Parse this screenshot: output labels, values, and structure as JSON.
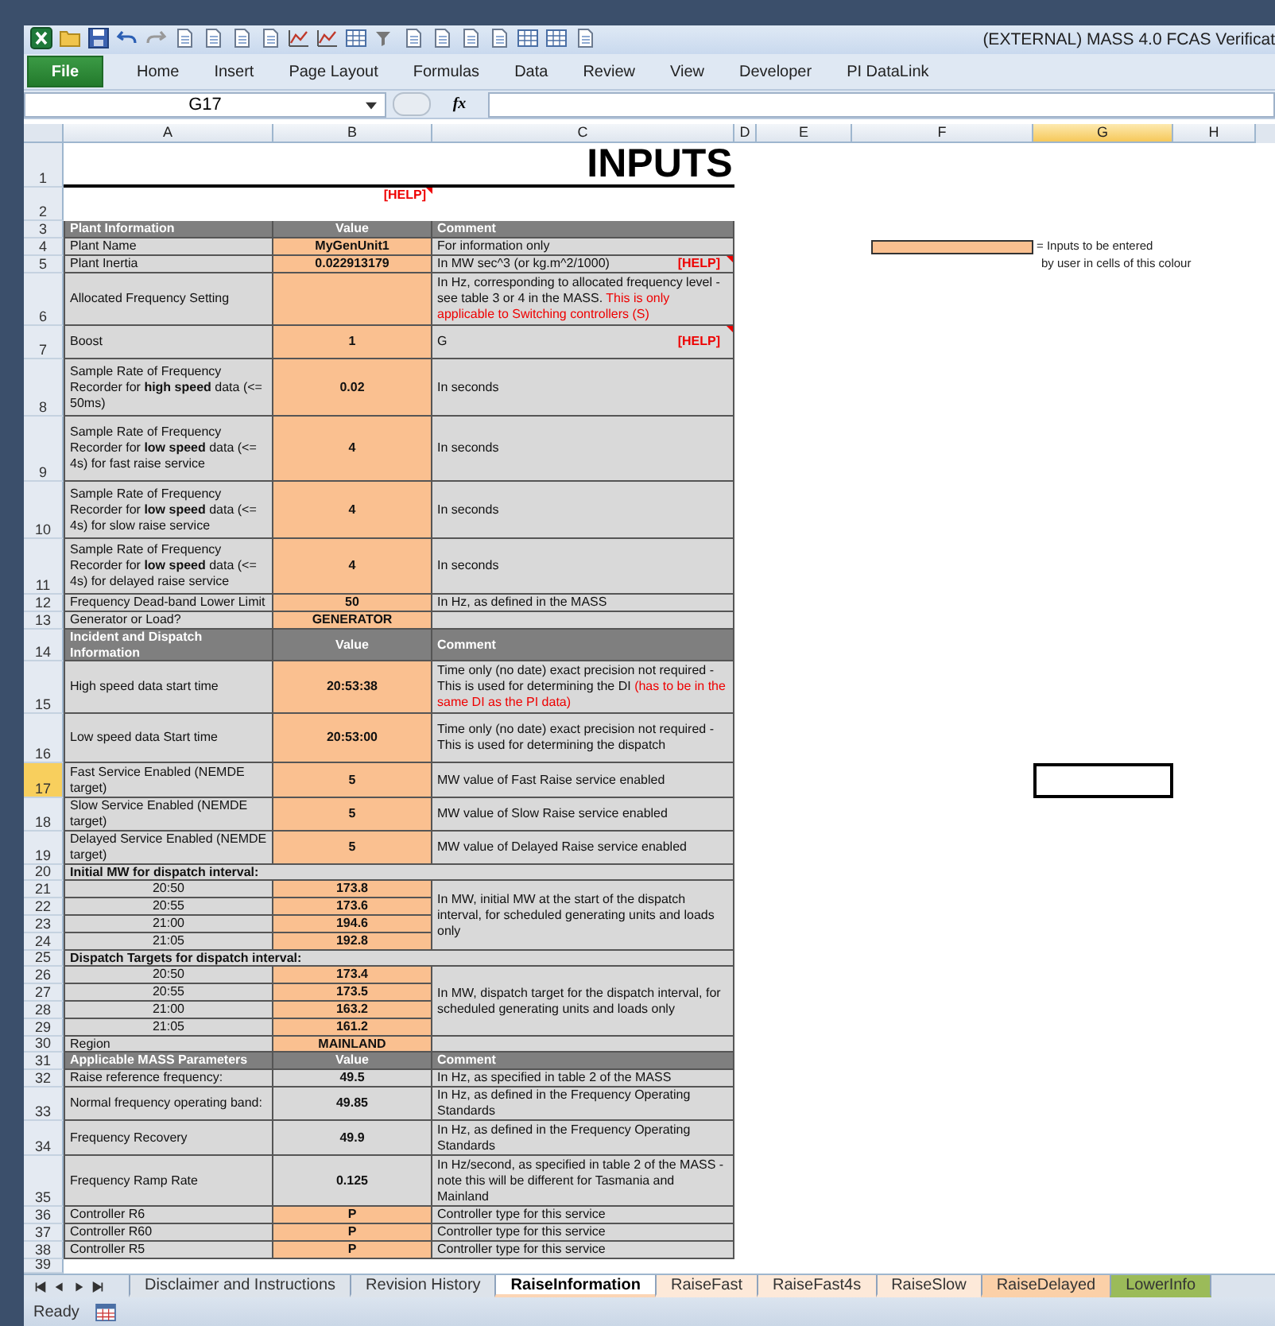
{
  "window": {
    "title": "(EXTERNAL) MASS 4.0 FCAS Verificat"
  },
  "file_button": "File",
  "ribbon_tabs": [
    "Home",
    "Insert",
    "Page Layout",
    "Formulas",
    "Data",
    "Review",
    "View",
    "Developer",
    "PI DataLink"
  ],
  "name_box": "G17",
  "formula_label": "fx",
  "columns": [
    {
      "label": "A",
      "selected": false
    },
    {
      "label": "B",
      "selected": false
    },
    {
      "label": "C",
      "selected": false
    },
    {
      "label": "D",
      "selected": false
    },
    {
      "label": "E",
      "selected": false
    },
    {
      "label": "F",
      "selected": false
    },
    {
      "label": "G",
      "selected": true
    },
    {
      "label": "H",
      "selected": false
    }
  ],
  "legend": {
    "line_1": "= Inputs to be entered",
    "line_2": "by user in cells of this colour"
  },
  "sheet": {
    "rows": [
      {
        "number": "1",
        "selected": false,
        "kind": "title",
        "text": "INPUTS"
      },
      {
        "number": "2",
        "selected": false,
        "kind": "help",
        "help": "[HELP]",
        "has_note": true
      },
      {
        "number": "3",
        "selected": false,
        "kind": "header",
        "label": "Plant Information",
        "value": "Value",
        "comment": "Comment"
      },
      {
        "number": "4",
        "selected": false,
        "kind": "field",
        "label": "Plant Name",
        "value": "MyGenUnit1",
        "input": true,
        "comment": "For information only"
      },
      {
        "number": "5",
        "selected": false,
        "kind": "field",
        "label": "Plant Inertia",
        "value": "0.022913179",
        "input": true,
        "comment": "In MW sec^3 (or kg.m^2/1000)",
        "help": "[HELP]",
        "has_note": true
      },
      {
        "number": "6",
        "selected": false,
        "kind": "field",
        "label": "Allocated Frequency Setting",
        "input": true,
        "comment": "In Hz, corresponding to allocated frequency level - see table 3 or 4 in the MASS.",
        "note": "This is only applicable to Switching controllers (S)"
      },
      {
        "number": "7",
        "selected": false,
        "kind": "field",
        "label": "Boost",
        "value": "1",
        "input": true,
        "comment": "G",
        "help": "[HELP]",
        "has_note": true
      },
      {
        "number": "8",
        "selected": false,
        "kind": "field",
        "label": "Sample Rate of Frequency Recorder for **high speed** data (<= 50ms)",
        "value": "0.02",
        "input": true,
        "comment": "In seconds"
      },
      {
        "number": "9",
        "selected": false,
        "kind": "field",
        "label": "Sample Rate of Frequency Recorder for **low speed** data (<= 4s) for fast raise service",
        "value": "4",
        "input": true,
        "comment": "In seconds"
      },
      {
        "number": "10",
        "selected": false,
        "kind": "field",
        "label": "Sample Rate of Frequency Recorder for **low speed** data (<= 4s) for slow raise service",
        "value": "4",
        "input": true,
        "comment": "In seconds"
      },
      {
        "number": "11",
        "selected": false,
        "kind": "field",
        "label": "Sample Rate of Frequency Recorder for **low speed** data (<= 4s) for delayed raise service",
        "value": "4",
        "input": true,
        "comment": "In seconds"
      },
      {
        "number": "12",
        "selected": false,
        "kind": "field",
        "label": "Frequency Dead-band Lower Limit",
        "value": "50",
        "input": true,
        "comment": "In Hz, as defined in the MASS"
      },
      {
        "number": "13",
        "selected": false,
        "kind": "field",
        "label": "Generator or Load?",
        "value": "GENERATOR",
        "input": true
      },
      {
        "number": "14",
        "selected": false,
        "kind": "header",
        "label": "Incident and Dispatch Information",
        "value": "Value",
        "comment": "Comment"
      },
      {
        "number": "15",
        "selected": false,
        "kind": "field",
        "label": "High speed data start time",
        "value": "20:53:38",
        "input": true,
        "comment": "Time only (no date) exact precision not required - This is used for determining the DI",
        "note": "(has to be in the same DI as the PI data)"
      },
      {
        "number": "16",
        "selected": false,
        "kind": "field",
        "label": "Low speed data Start time",
        "value": "20:53:00",
        "input": true,
        "comment": "Time only (no date) exact precision not required - This is used for determining the dispatch"
      },
      {
        "number": "17",
        "selected": true,
        "kind": "field",
        "label": "Fast Service Enabled (NEMDE target)",
        "value": "5",
        "input": true,
        "comment": "MW value of Fast Raise service enabled"
      },
      {
        "number": "18",
        "selected": false,
        "kind": "field",
        "label": "Slow Service Enabled (NEMDE target)",
        "value": "5",
        "input": true,
        "comment": "MW value of Slow Raise service enabled"
      },
      {
        "number": "19",
        "selected": false,
        "kind": "field",
        "label": "Delayed Service Enabled (NEMDE target)",
        "value": "5",
        "input": true,
        "comment": "MW value of Delayed Raise service enabled"
      },
      {
        "number": "20",
        "selected": false,
        "kind": "section",
        "text": "Initial MW for dispatch interval:"
      },
      {
        "number": "21",
        "selected": false,
        "kind": "interval",
        "label": "20:50",
        "value": "173.8",
        "input": true,
        "comment": "In MW, initial MW at the start of the dispatch interval, for scheduled generating units and loads only"
      },
      {
        "number": "22",
        "selected": false,
        "kind": "interval",
        "label": "20:55",
        "value": "173.6",
        "input": true
      },
      {
        "number": "23",
        "selected": false,
        "kind": "interval",
        "label": "21:00",
        "value": "194.6",
        "input": true
      },
      {
        "number": "24",
        "selected": false,
        "kind": "interval",
        "label": "21:05",
        "value": "192.8",
        "input": true
      },
      {
        "number": "25",
        "selected": false,
        "kind": "section",
        "text": "Dispatch Targets for dispatch interval:"
      },
      {
        "number": "26",
        "selected": false,
        "kind": "interval",
        "label": "20:50",
        "value": "173.4",
        "input": true,
        "comment": "In MW, dispatch target for the dispatch interval, for scheduled generating units and loads only"
      },
      {
        "number": "27",
        "selected": false,
        "kind": "interval",
        "label": "20:55",
        "value": "173.5",
        "input": true
      },
      {
        "number": "28",
        "selected": false,
        "kind": "interval",
        "label": "21:00",
        "value": "163.2",
        "input": true
      },
      {
        "number": "29",
        "selected": false,
        "kind": "interval",
        "label": "21:05",
        "value": "161.2",
        "input": true
      },
      {
        "number": "30",
        "selected": false,
        "kind": "field",
        "label": "Region",
        "value": "MAINLAND",
        "input": true
      },
      {
        "number": "31",
        "selected": false,
        "kind": "header",
        "label": "Applicable MASS Parameters",
        "value": "Value",
        "comment": "Comment"
      },
      {
        "number": "32",
        "selected": false,
        "kind": "field",
        "label": "Raise reference frequency:",
        "value": "49.5",
        "input": false,
        "comment": "In Hz, as specified in table 2 of the MASS"
      },
      {
        "number": "33",
        "selected": false,
        "kind": "field",
        "label": "Normal frequency operating band:",
        "value": "49.85",
        "input": false,
        "comment": "In Hz, as defined in the Frequency Operating Standards"
      },
      {
        "number": "34",
        "selected": false,
        "kind": "field",
        "label": "Frequency Recovery",
        "value": "49.9",
        "input": false,
        "comment": "In Hz, as defined in the Frequency Operating Standards"
      },
      {
        "number": "35",
        "selected": false,
        "kind": "field",
        "label": "Frequency Ramp Rate",
        "value": "0.125",
        "input": false,
        "comment": "In Hz/second, as specified in table 2 of the MASS - note this will be different for Tasmania and Mainland"
      },
      {
        "number": "36",
        "selected": false,
        "kind": "field",
        "label": "Controller R6",
        "value": "P",
        "input": true,
        "comment": "Controller type for this service"
      },
      {
        "number": "37",
        "selected": false,
        "kind": "field",
        "label": "Controller R60",
        "value": "P",
        "input": true,
        "comment": "Controller type for this service"
      },
      {
        "number": "38",
        "selected": false,
        "kind": "field",
        "label": "Controller R5",
        "value": "P",
        "input": true,
        "comment": "Controller type for this service"
      },
      {
        "number": "39",
        "selected": false,
        "kind": "blank"
      }
    ]
  },
  "sheet_tabs": [
    {
      "label": "Disclaimer and Instructions",
      "selected": false,
      "color": "#dde3ea"
    },
    {
      "label": "Revision History",
      "selected": false,
      "color": "#dde3ea"
    },
    {
      "label": "RaiseInformation",
      "selected": true,
      "color": "#fbd5b5"
    },
    {
      "label": "RaiseFast",
      "selected": false,
      "color": "#fde9d9"
    },
    {
      "label": "RaiseFast4s",
      "selected": false,
      "color": "#fde9d9"
    },
    {
      "label": "RaiseSlow",
      "selected": false,
      "color": "#fde9d9"
    },
    {
      "label": "RaiseDelayed",
      "selected": false,
      "color": "#fbd0a8"
    },
    {
      "label": "LowerInfo",
      "selected": false,
      "color": "#9bbb59"
    }
  ],
  "status_bar": {
    "text": "Ready"
  }
}
